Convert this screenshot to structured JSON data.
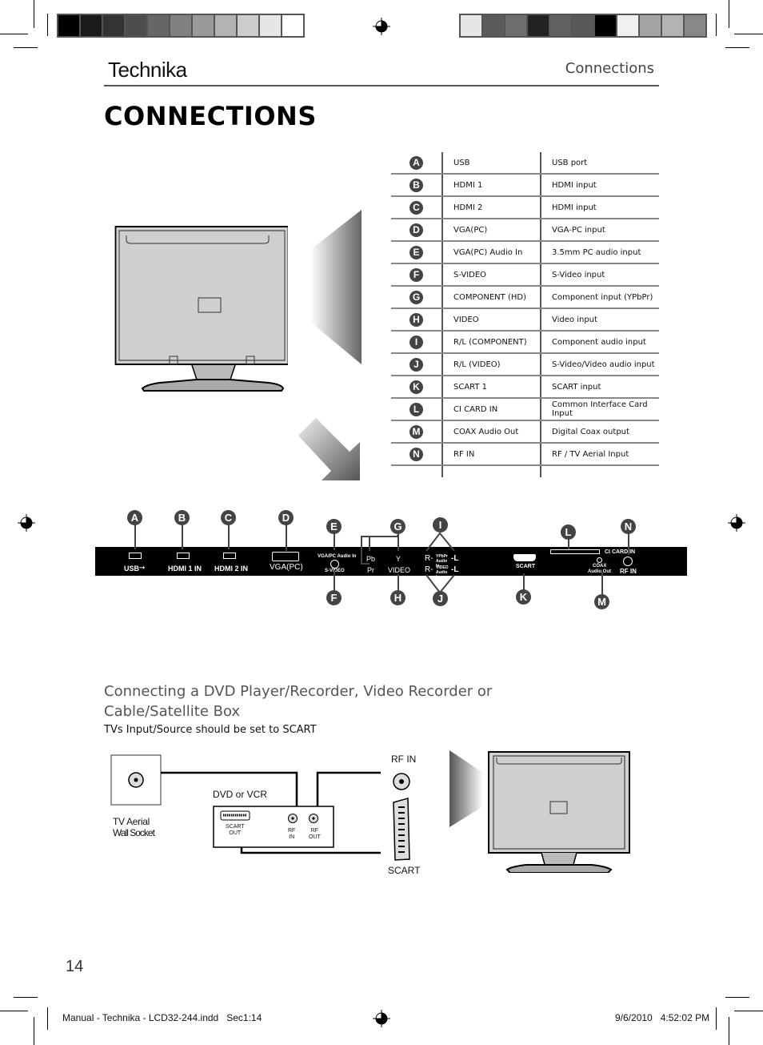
{
  "print_marks": {
    "grayscale_left": [
      "#000000",
      "#1a1a1a",
      "#333333",
      "#4d4d4d",
      "#666666",
      "#808080",
      "#999999",
      "#b3b3b3",
      "#cccccc",
      "#e6e6e6",
      "#ffffff"
    ],
    "grayscale_right": [
      "#e6e6e6",
      "#5a5a5a",
      "#6e6e6e",
      "#222222",
      "#606060",
      "#585858",
      "#000000",
      "#f0f0f0",
      "#a3a3a3",
      "#b3b3b3",
      "#888888"
    ]
  },
  "header": {
    "brand": "Technika",
    "section": "Connections"
  },
  "page_title": "CONNECTIONS",
  "connections_table": {
    "rows": [
      {
        "letter": "A",
        "name": "USB",
        "description": "USB port"
      },
      {
        "letter": "B",
        "name": "HDMI 1",
        "description": "HDMI input"
      },
      {
        "letter": "C",
        "name": "HDMI 2",
        "description": "HDMI input"
      },
      {
        "letter": "D",
        "name": "VGA(PC)",
        "description": "VGA-PC input"
      },
      {
        "letter": "E",
        "name": "VGA(PC) Audio In",
        "description": "3.5mm PC audio input"
      },
      {
        "letter": "F",
        "name": "S-VIDEO",
        "description": "S-Video input"
      },
      {
        "letter": "G",
        "name": "COMPONENT (HD)",
        "description": "Component  input (YPbPr)"
      },
      {
        "letter": "H",
        "name": "VIDEO",
        "description": "Video input"
      },
      {
        "letter": "I",
        "name": "R/L (COMPONENT)",
        "description": "Component audio input"
      },
      {
        "letter": "J",
        "name": "R/L (VIDEO)",
        "description": "S-Video/Video audio input"
      },
      {
        "letter": "K",
        "name": "SCART 1",
        "description": "SCART input"
      },
      {
        "letter": "L",
        "name": "CI CARD IN",
        "description": "Common Interface Card Input"
      },
      {
        "letter": "M",
        "name": "COAX Audio Out",
        "description": "Digital Coax output"
      },
      {
        "letter": "N",
        "name": "RF IN",
        "description": "RF / TV Aerial Input"
      }
    ]
  },
  "panel": {
    "labels": {
      "usb": "USB",
      "hdmi1": "HDMI 1 IN",
      "hdmi2": "HDMI 2 IN",
      "vga": "VGA(PC)",
      "vga_audio": "VGA/PC Audio In",
      "svideo": "S-VIDEO",
      "pb": "Pb",
      "pr": "Pr",
      "y": "Y",
      "video": "VIDEO",
      "r1": "R-",
      "l1": "-L",
      "r2": "R-",
      "l2": "-L",
      "ypbpr_audio": "YPbPr Audio In",
      "video_audio": "VIDEO Audio In",
      "scart": "SCART",
      "ci_card": "CI  CARD  IN",
      "coax": "COAX",
      "audio_out": "Audio Out",
      "rf_in": "RF IN"
    },
    "callouts": [
      "A",
      "B",
      "C",
      "D",
      "E",
      "F",
      "G",
      "H",
      "I",
      "J",
      "K",
      "L",
      "M",
      "N"
    ]
  },
  "dvd_section": {
    "heading_line1": "Connecting a DVD Player/Recorder, Video Recorder or",
    "heading_line2": "Cable/Satellite Box",
    "note": "TVs Input/Source should be set to SCART",
    "diagram": {
      "wall_socket_line1": "TV Aerial",
      "wall_socket_line2": "Wall Socket",
      "device_label": "DVD or VCR",
      "scart_out_line1": "SCART",
      "scart_out_line2": "OUT",
      "rf_in_line1": "RF",
      "rf_in_line2": "IN",
      "rf_out_line1": "RF",
      "rf_out_line2": "OUT",
      "tv_rf_in": "RF IN",
      "tv_scart": "SCART"
    }
  },
  "footer": {
    "page_number": "14",
    "slug_file": "Manual - Technika - LCD32-244.indd   Sec1:14",
    "slug_date": "9/6/2010   4:52:02 PM"
  }
}
